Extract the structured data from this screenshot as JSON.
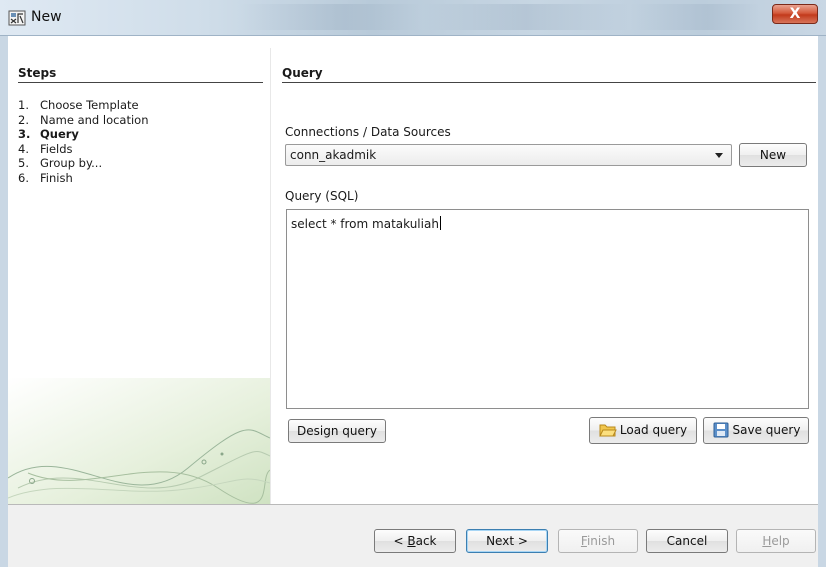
{
  "window": {
    "title": "New",
    "close_glyph": "X",
    "icon": "report-wizard-icon"
  },
  "steps": {
    "title": "Steps",
    "items": [
      {
        "num": "1.",
        "label": "Choose Template"
      },
      {
        "num": "2.",
        "label": "Name and location"
      },
      {
        "num": "3.",
        "label": "Query"
      },
      {
        "num": "4.",
        "label": "Fields"
      },
      {
        "num": "5.",
        "label": "Group by..."
      },
      {
        "num": "6.",
        "label": "Finish"
      }
    ],
    "active_index": 2
  },
  "query": {
    "title": "Query",
    "connections_label": "Connections / Data Sources",
    "connection_value": "conn_akadmik",
    "new_button": "New",
    "sql_label": "Query (SQL)",
    "sql_text": "select * from matakuliah",
    "design_button": "Design query",
    "load_button": "Load query",
    "save_button": "Save query"
  },
  "footer": {
    "back_prefix": "< ",
    "back_mnemonic": "B",
    "back_rest": "ack",
    "next_label": "Next >",
    "finish_mnemonic": "F",
    "finish_rest": "inish",
    "cancel_label": "Cancel",
    "help_mnemonic": "H",
    "help_rest": "elp"
  },
  "colors": {
    "titlebar": "#c9d7e4",
    "close_button": "#c8432a",
    "default_button_border": "#3c7fb1"
  }
}
